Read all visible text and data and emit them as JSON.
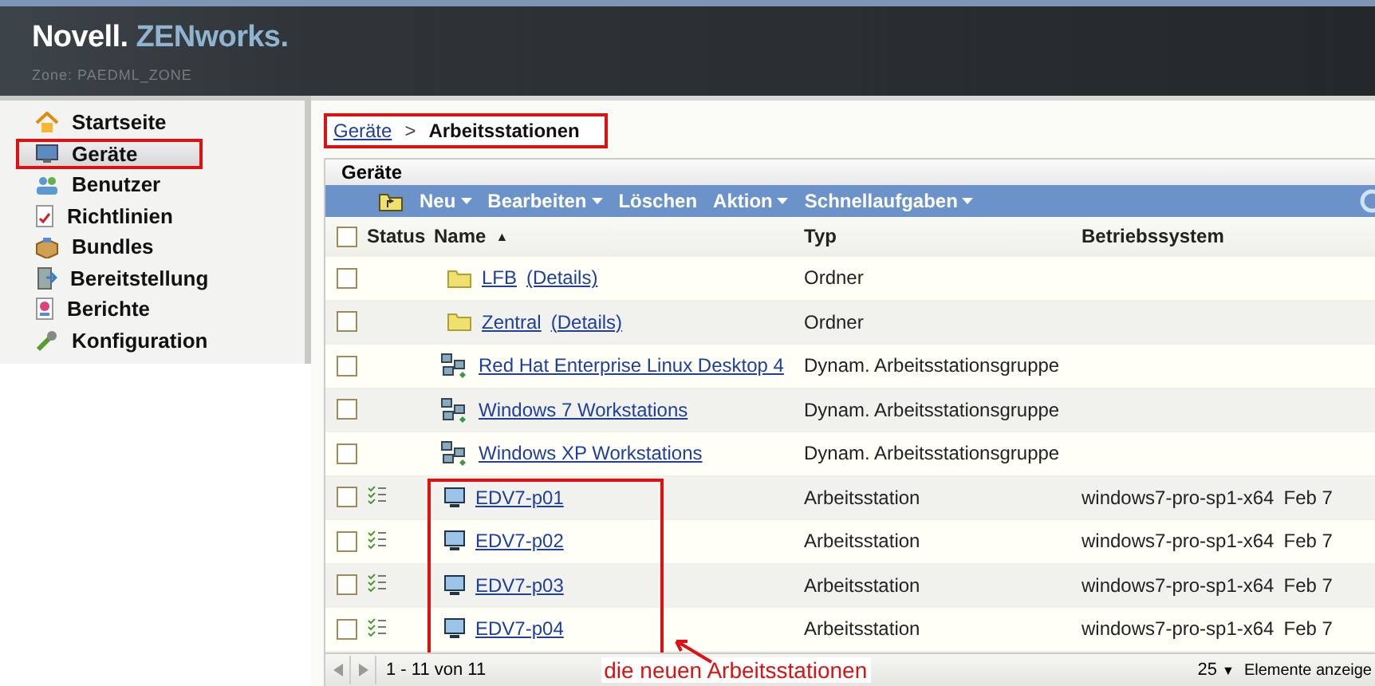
{
  "header": {
    "brand": "Novell.",
    "product": "ZENworks.",
    "zone": "Zone: PAEDML_ZONE"
  },
  "sidebar": {
    "items": [
      {
        "label": "Startseite",
        "selected": false,
        "highlighted": false
      },
      {
        "label": "Geräte",
        "selected": true,
        "highlighted": true
      },
      {
        "label": "Benutzer",
        "selected": false,
        "highlighted": false
      },
      {
        "label": "Richtlinien",
        "selected": false,
        "highlighted": false
      },
      {
        "label": "Bundles",
        "selected": false,
        "highlighted": false
      },
      {
        "label": "Bereitstellung",
        "selected": false,
        "highlighted": false
      },
      {
        "label": "Berichte",
        "selected": false,
        "highlighted": false
      },
      {
        "label": "Konfiguration",
        "selected": false,
        "highlighted": false
      }
    ]
  },
  "breadcrumb": {
    "highlighted": true,
    "link": "Geräte",
    "separator": ">",
    "current": "Arbeitsstationen"
  },
  "panel": {
    "title": "Geräte",
    "toolbar": [
      {
        "label": "Neu",
        "menu": true
      },
      {
        "label": "Bearbeiten",
        "menu": true
      },
      {
        "label": "Löschen",
        "menu": false
      },
      {
        "label": "Aktion",
        "menu": true
      },
      {
        "label": "Schnellaufgaben",
        "menu": true
      }
    ],
    "select_all_checked": false,
    "columns": [
      "Status",
      "Name",
      "Typ",
      "Betriebssystem"
    ],
    "sort_mark": "▲",
    "rows": [
      {
        "kind": "folder",
        "checked": false,
        "status": false,
        "name": "LFB",
        "details": "(Details)",
        "type": "Ordner",
        "callout": false
      },
      {
        "kind": "folder",
        "checked": false,
        "status": false,
        "name": "Zentral",
        "details": "(Details)",
        "type": "Ordner",
        "callout": false
      },
      {
        "kind": "group",
        "checked": false,
        "status": false,
        "name": "Red Hat Enterprise Linux Desktop 4",
        "type": "Dynam. Arbeitsstationsgruppe",
        "callout": false
      },
      {
        "kind": "group",
        "checked": false,
        "status": false,
        "name": "Windows 7 Workstations",
        "type": "Dynam. Arbeitsstationsgruppe",
        "callout": false
      },
      {
        "kind": "group",
        "checked": false,
        "status": false,
        "name": "Windows XP Workstations",
        "type": "Dynam. Arbeitsstationsgruppe",
        "callout": false
      },
      {
        "kind": "workstation",
        "checked": false,
        "status": true,
        "name": "EDV7-p01",
        "type": "Arbeitsstation",
        "os": "windows7-pro-sp1-x64",
        "column_5": "Feb 7",
        "callout": true
      },
      {
        "kind": "workstation",
        "checked": false,
        "status": true,
        "name": "EDV7-p02",
        "type": "Arbeitsstation",
        "os": "windows7-pro-sp1-x64",
        "column_5": "Feb 7",
        "callout": true
      },
      {
        "kind": "workstation",
        "checked": false,
        "status": true,
        "name": "EDV7-p03",
        "type": "Arbeitsstation",
        "os": "windows7-pro-sp1-x64",
        "column_5": "Feb 7",
        "callout": true
      },
      {
        "kind": "workstation",
        "checked": false,
        "status": true,
        "name": "EDV7-p04",
        "type": "Arbeitsstation",
        "os": "windows7-pro-sp1-x64",
        "column_5": "Feb 7",
        "callout": true
      }
    ],
    "pager": {
      "range": "1 - 11 von 11",
      "page_size": "25",
      "page_size_caret": "▼",
      "page_size_label": "Elemente anzeige"
    }
  },
  "annotation": {
    "text": "die neuen Arbeitsstationen"
  }
}
